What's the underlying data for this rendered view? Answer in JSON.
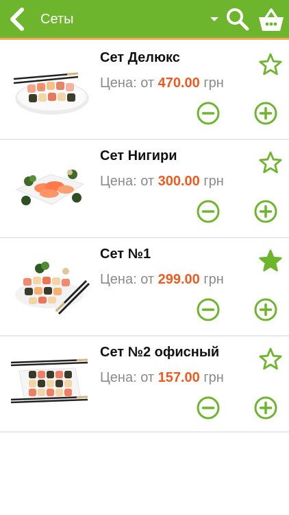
{
  "header": {
    "title": "Сеты",
    "back_icon": "back-chevron-icon",
    "dropdown_icon": "dropdown-arrow-icon",
    "search_icon": "search-icon",
    "cart_icon": "basket-icon",
    "bg_color": "#6cb52d",
    "accent_line_color": "#f3a85a"
  },
  "colors": {
    "accent_green": "#6cb52d",
    "price_orange": "#ef5a1f"
  },
  "items": [
    {
      "name": "Сет Делюкс",
      "price_prefix": "Цена: от",
      "price": "470.00",
      "currency": "грн",
      "favorite": false
    },
    {
      "name": "Сет Нигири",
      "price_prefix": "Цена: от",
      "price": "300.00",
      "currency": "грн",
      "favorite": false
    },
    {
      "name": "Сет №1",
      "price_prefix": "Цена: от",
      "price": "299.00",
      "currency": "грн",
      "favorite": true
    },
    {
      "name": "Сет №2 офисный",
      "price_prefix": "Цена: от",
      "price": "157.00",
      "currency": "грн",
      "favorite": false
    }
  ]
}
